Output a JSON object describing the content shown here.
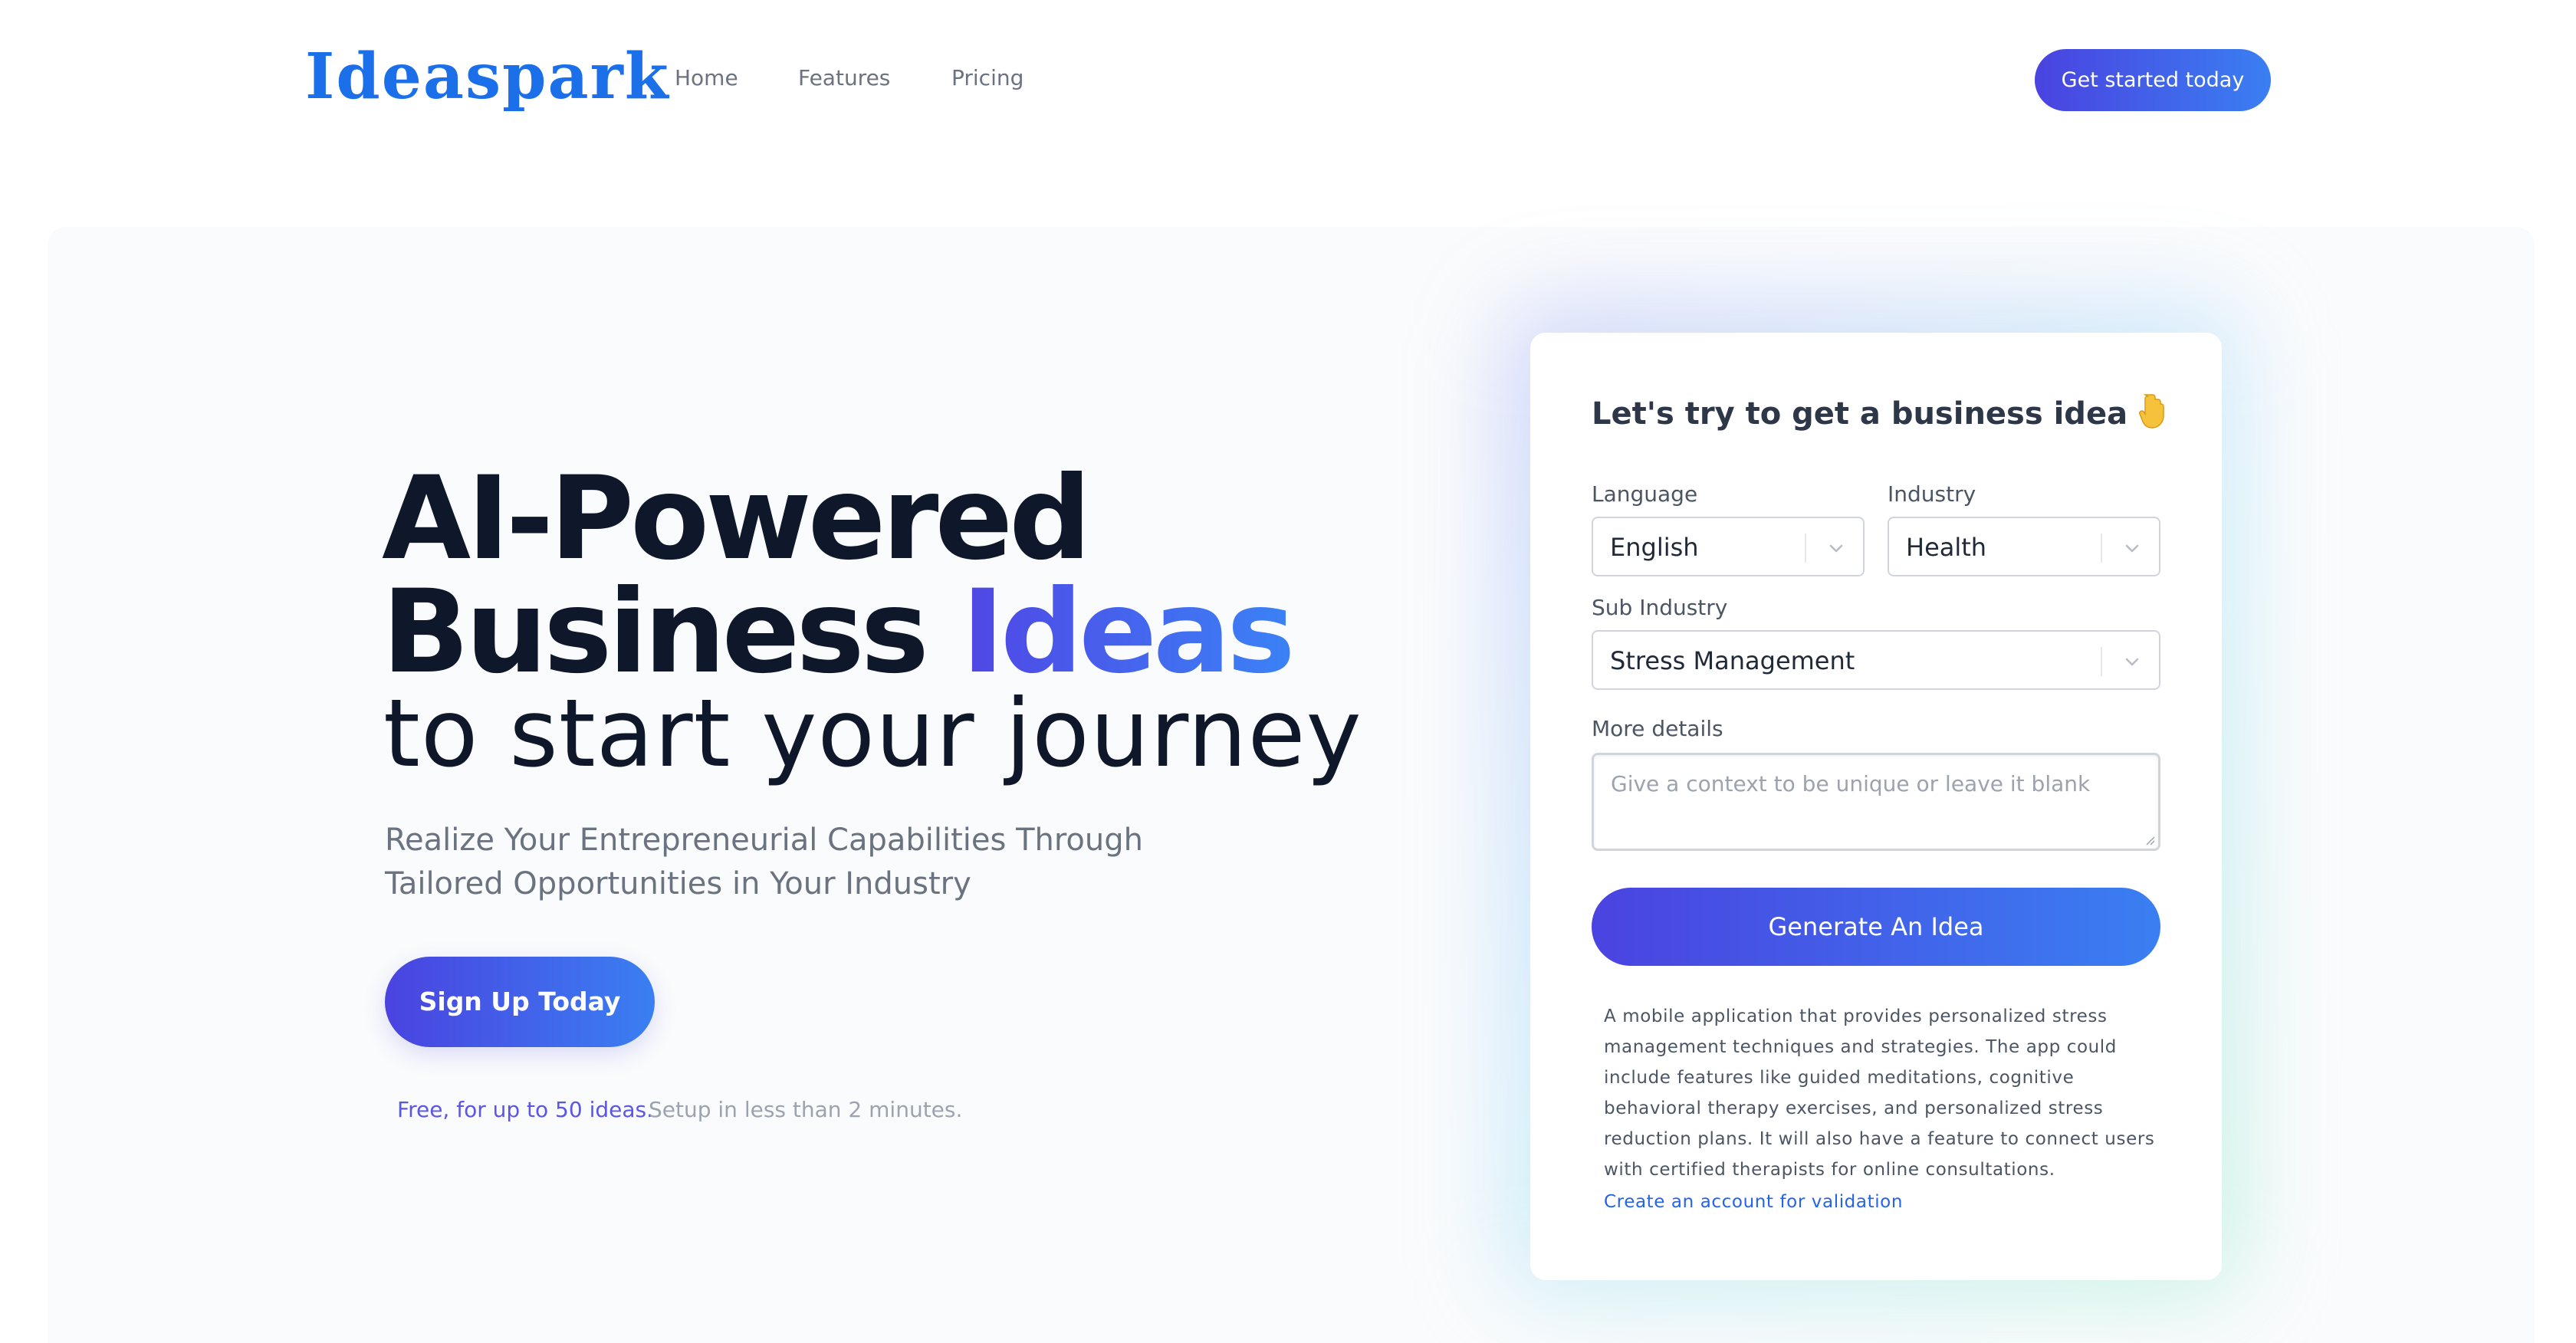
{
  "brand": {
    "name": "Ideaspark",
    "accent_color": "#1b6fe8",
    "gradient_start": "#4a43e0",
    "gradient_end": "#3a7ff2"
  },
  "nav": {
    "links": [
      "Home",
      "Features",
      "Pricing"
    ],
    "cta_label": "Get started today"
  },
  "hero": {
    "heading_line1": "AI-Powered",
    "heading_line2_plain": "Business ",
    "heading_line2_accent": "Ideas",
    "heading_line3": "to start your journey",
    "subheading": "Realize Your Entrepreneurial Capabilities Through Tailored Opportunities in Your Industry",
    "signup_label": "Sign Up Today",
    "free_note": "Free, for up to 50 ideas.",
    "setup_note": "Setup in less than 2 minutes."
  },
  "form": {
    "title": "Let's try to get a business idea",
    "title_icon": "pointing-down-hand-icon",
    "language": {
      "label": "Language",
      "value": "English"
    },
    "industry": {
      "label": "Industry",
      "value": "Health"
    },
    "sub_industry": {
      "label": "Sub Industry",
      "value": "Stress Management"
    },
    "more_details": {
      "label": "More details",
      "placeholder": "Give a context to be unique or leave it blank"
    },
    "generate_label": "Generate An Idea",
    "result_text": "A mobile application that provides personalized stress management techniques and strategies. The app could include features like guided meditations, cognitive behavioral therapy exercises, and personalized stress reduction plans. It will also have a feature to connect users with certified therapists for online consultations.",
    "result_link": "Create an account for validation"
  }
}
